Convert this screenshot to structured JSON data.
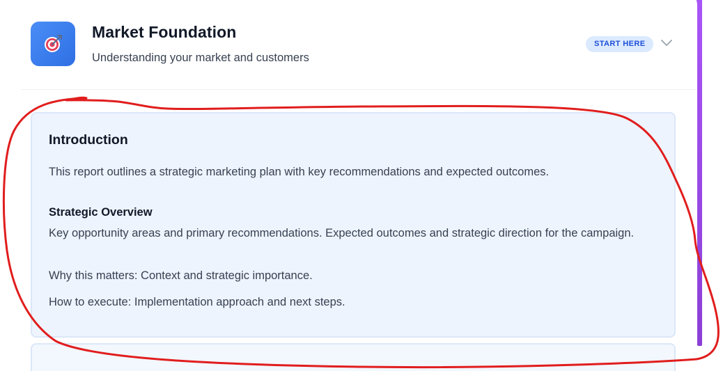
{
  "header": {
    "icon": "target-icon",
    "title": "Market Foundation",
    "subtitle": "Understanding your market and customers",
    "badge": "START HERE",
    "toggle_icon": "chevron-down-icon"
  },
  "intro": {
    "title": "Introduction",
    "text": "This report outlines a strategic marketing plan with key recommendations and expected outcomes.",
    "overview_heading": "Strategic Overview",
    "overview_body": "Key opportunity areas and primary recommendations. Expected outcomes and strategic direction for the campaign.",
    "why": "Why this matters: Context and strategic importance.",
    "how": "How to execute: Implementation approach and next steps."
  },
  "colors": {
    "accent_bar": "#a855f7",
    "icon_bg": "#3b82f6",
    "badge_bg": "#dbeafe",
    "badge_text": "#1d4ed8",
    "section_bg": "#eef4fe",
    "annotation_stroke": "#e11d1d"
  }
}
